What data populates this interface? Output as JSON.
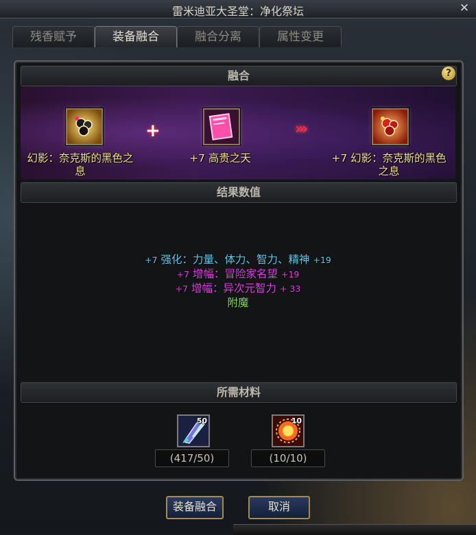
{
  "window": {
    "title": "雷米迪亚大圣堂：净化祭坛",
    "close_symbol": "✕"
  },
  "tabs": [
    {
      "label": "残香赋予",
      "active": false
    },
    {
      "label": "装备融合",
      "active": true
    },
    {
      "label": "融合分离",
      "active": false
    },
    {
      "label": "属性变更",
      "active": false
    }
  ],
  "fusion": {
    "header": "融合",
    "help_symbol": "?",
    "plus_symbol": "+",
    "arrow_symbol": "›››",
    "items": {
      "base": {
        "name": "幻影：奈克斯的黑色之息",
        "icon": "dark-flower-icon"
      },
      "material": {
        "name": "+7 高贵之天",
        "icon": "pink-book-icon"
      },
      "result": {
        "name": "+7 幻影：奈克斯的黑色之息",
        "icon": "red-flower-icon"
      }
    }
  },
  "result": {
    "header": "结果数值",
    "lines": [
      {
        "level": "+7",
        "text": "强化：力量、体力、智力、精神",
        "value": "+19",
        "color": "#5ec8f0"
      },
      {
        "level": "+7",
        "text": "增幅：冒险家名望",
        "value": "+19",
        "color": "#e040e0"
      },
      {
        "level": "+7",
        "text": "增幅：异次元智力",
        "value": "+ 33",
        "color": "#e040e0"
      },
      {
        "level": "",
        "text": "附魔",
        "value": "",
        "color": "#7ee050"
      }
    ]
  },
  "materials": {
    "header": "所需材料",
    "list": [
      {
        "icon": "crystal-shard-icon",
        "stack": "50",
        "quantity": "(417/50)"
      },
      {
        "icon": "sun-orb-icon",
        "stack": "10",
        "quantity": "(10/10)"
      }
    ]
  },
  "buttons": {
    "confirm": "装备融合",
    "cancel": "取消"
  },
  "colors": {
    "accent_gold": "#a78c52",
    "item_name": "#f3e28a",
    "stat_blue": "#5ec8f0",
    "stat_magenta": "#e040e0",
    "stat_green": "#7ee050"
  }
}
